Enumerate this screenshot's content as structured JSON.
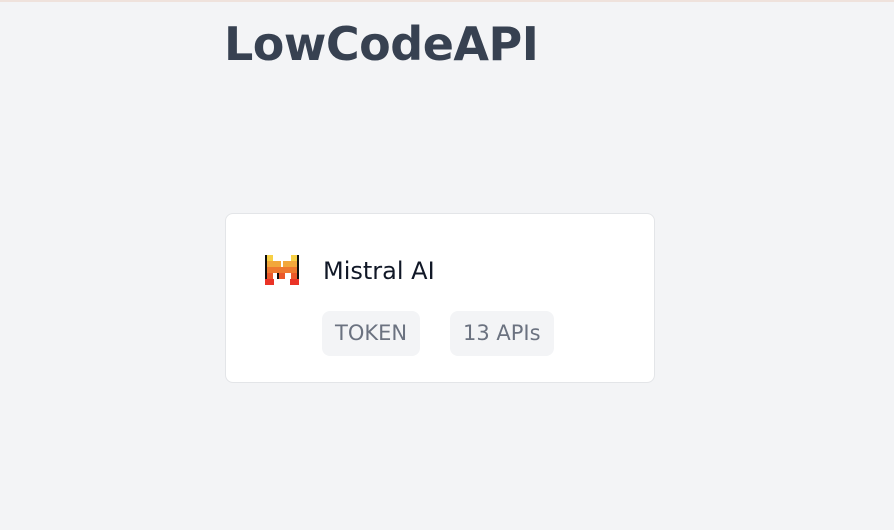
{
  "header": {
    "title": "LowCodeAPI"
  },
  "provider_card": {
    "name": "Mistral AI",
    "logo_icon": "mistral-logo-icon",
    "auth_type": "TOKEN",
    "api_count_label": "13 APIs"
  },
  "colors": {
    "background": "#f3f4f6",
    "title_text": "#374151",
    "card_background": "#ffffff",
    "badge_background": "#f3f4f6",
    "badge_text": "#6b7280",
    "logo_black": "#0f0f0f",
    "logo_yellow": "#f7d046",
    "logo_orange": "#f2a73b",
    "logo_dark_orange": "#ee792f",
    "logo_red": "#eb5829"
  }
}
